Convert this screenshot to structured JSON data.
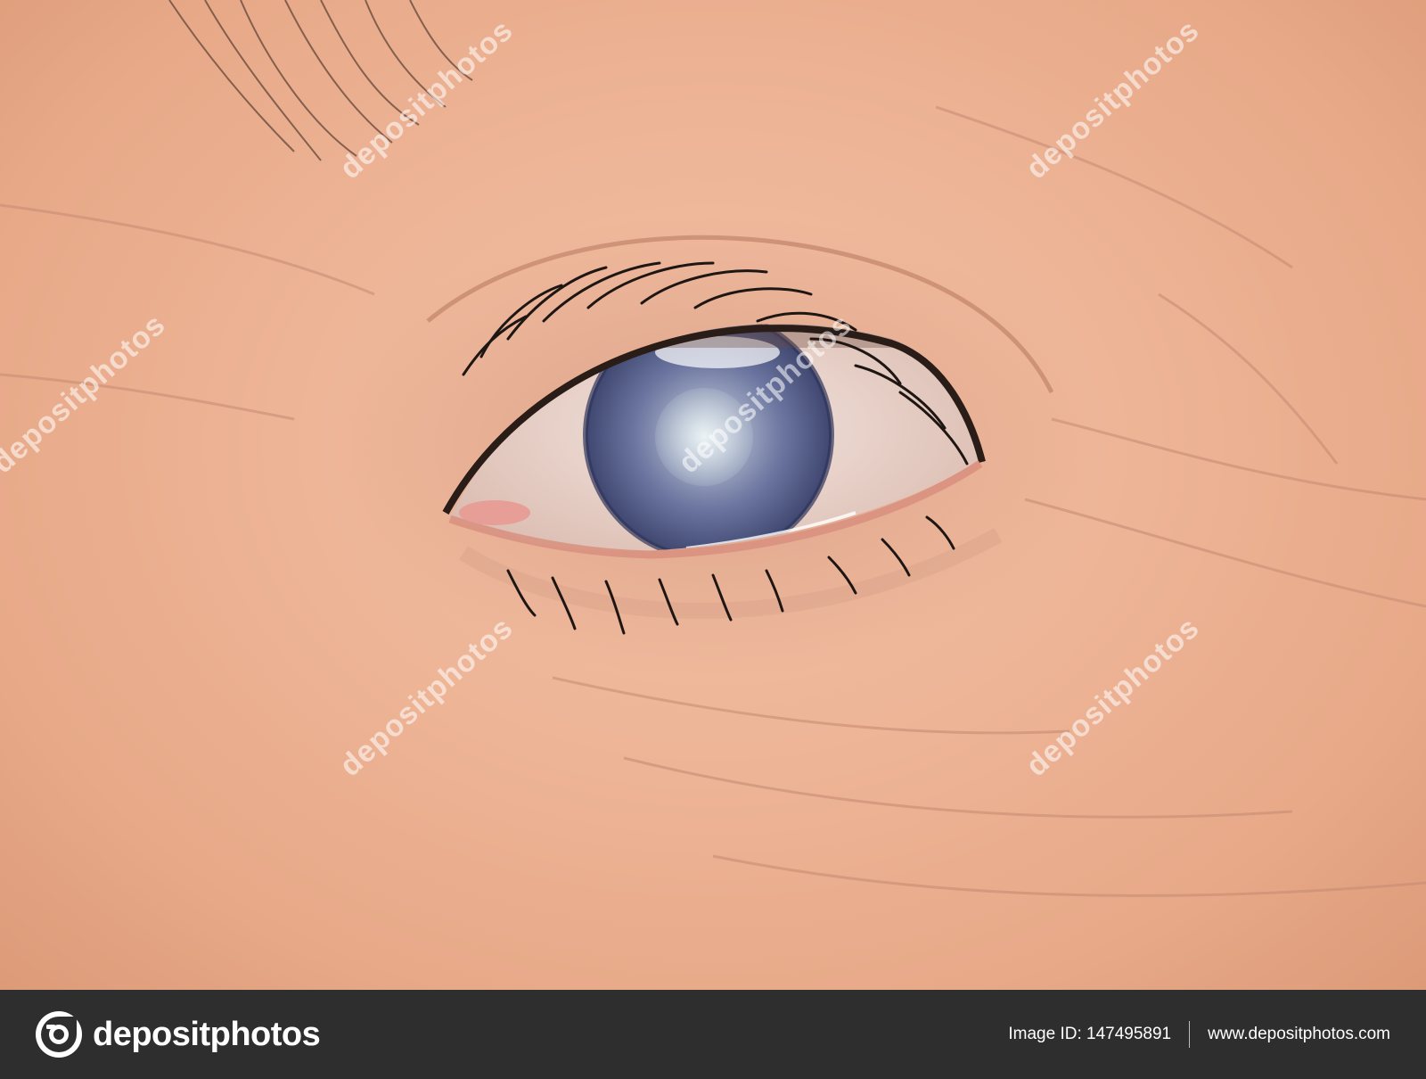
{
  "watermark": {
    "text": "depositphotos"
  },
  "footer": {
    "brand_name": "depositphotos",
    "image_id": "Image ID: 147495891",
    "website": "www.depositphotos.com"
  },
  "colors": {
    "skin": "#eeb597",
    "iris": "#5d6790",
    "footer_bg": "#2e2e2e"
  }
}
